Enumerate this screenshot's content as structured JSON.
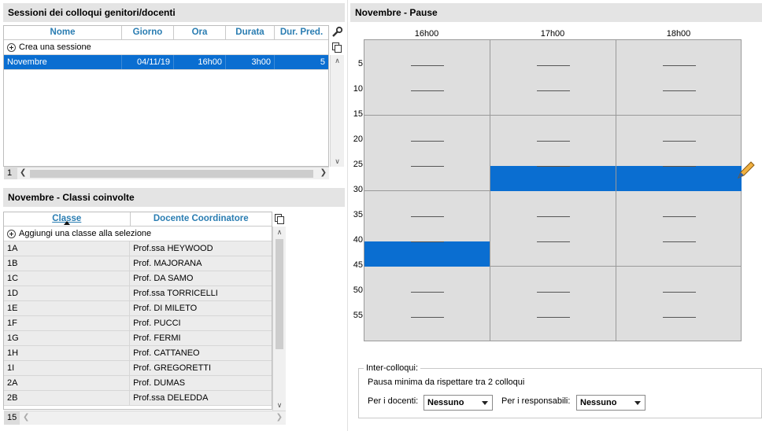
{
  "sessions": {
    "title": "Sessioni dei colloqui genitori/docenti",
    "columns": [
      "Nome",
      "Giorno",
      "Ora",
      "Durata",
      "Dur. Pred."
    ],
    "add_label": "Crea una sessione",
    "rows": [
      {
        "nome": "Novembre",
        "giorno": "04/11/19",
        "ora": "16h00",
        "durata": "3h00",
        "dur_pred": "5"
      }
    ],
    "count": "1"
  },
  "classes": {
    "title": "Novembre - Classi coinvolte",
    "columns": [
      "Classe",
      "Docente Coordinatore"
    ],
    "add_label": "Aggiungi una classe alla selezione",
    "rows": [
      {
        "classe": "1A",
        "docente": "Prof.ssa HEYWOOD"
      },
      {
        "classe": "1B",
        "docente": "Prof. MAJORANA"
      },
      {
        "classe": "1C",
        "docente": "Prof. DA SAMO"
      },
      {
        "classe": "1D",
        "docente": "Prof.ssa TORRICELLI"
      },
      {
        "classe": "1E",
        "docente": "Prof. DI MILETO"
      },
      {
        "classe": "1F",
        "docente": "Prof. PUCCI"
      },
      {
        "classe": "1G",
        "docente": "Prof. FERMI"
      },
      {
        "classe": "1H",
        "docente": "Prof. CATTANEO"
      },
      {
        "classe": "1I",
        "docente": "Prof. GREGORETTI"
      },
      {
        "classe": "2A",
        "docente": "Prof. DUMAS"
      },
      {
        "classe": "2B",
        "docente": "Prof.ssa DELEDDA"
      }
    ],
    "count": "15"
  },
  "pauses": {
    "title": "Novembre - Pause",
    "hours": [
      "16h00",
      "17h00",
      "18h00"
    ],
    "minutes": [
      "5",
      "10",
      "15",
      "20",
      "25",
      "30",
      "35",
      "40",
      "45",
      "50",
      "55"
    ],
    "blocks": [
      {
        "hour_index": 0,
        "start_min": 40,
        "end_min": 45
      },
      {
        "hour_index": 1,
        "start_min": 25,
        "end_min": 30
      },
      {
        "hour_index": 2,
        "start_min": 25,
        "end_min": 30
      }
    ]
  },
  "inter": {
    "legend": "Inter-colloqui:",
    "description": "Pausa minima da rispettare tra 2 colloqui",
    "docenti_label": "Per i docenti:",
    "docenti_value": "Nessuno",
    "responsabili_label": "Per i responsabili:",
    "responsabili_value": "Nessuno"
  },
  "colors": {
    "accent": "#0a6ed1",
    "header_text": "#2a7db2",
    "panel_header": "#e4e4e4"
  }
}
